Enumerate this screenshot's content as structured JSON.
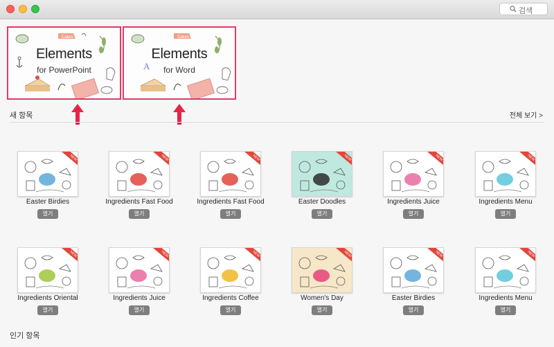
{
  "window": {
    "search_placeholder": "검색"
  },
  "banners": [
    {
      "title": "Elements",
      "subtitle": "for PowerPoint",
      "badge": "Cakes"
    },
    {
      "title": "Elements",
      "subtitle": "for Word",
      "badge": "Cakes"
    }
  ],
  "new_section": {
    "title": "새 항목",
    "see_all": "전체 보기 >"
  },
  "popular_section": {
    "title": "인기 항목"
  },
  "open_label": "열기",
  "ribbon_label": "NEW",
  "items": [
    {
      "name": "Easter Birdies",
      "bg": "#ffffff",
      "accent": "#5aa8d8"
    },
    {
      "name": "Ingredients Fast Food",
      "bg": "#ffffff",
      "accent": "#e2453b"
    },
    {
      "name": "Ingredients Fast Food",
      "bg": "#ffffff",
      "accent": "#e2453b"
    },
    {
      "name": "Easter Doodles",
      "bg": "#bfe8de",
      "accent": "#2c2c2c"
    },
    {
      "name": "Ingredients Juice",
      "bg": "#ffffff",
      "accent": "#e86aa0"
    },
    {
      "name": "Ingredients Menu",
      "bg": "#ffffff",
      "accent": "#5bc6d8"
    },
    {
      "name": "Ingredients Oriental",
      "bg": "#ffffff",
      "accent": "#9cc83a"
    },
    {
      "name": "Ingredients Juice",
      "bg": "#ffffff",
      "accent": "#e86aa0"
    },
    {
      "name": "Ingredients Coffee",
      "bg": "#ffffff",
      "accent": "#f0b626"
    },
    {
      "name": "Women's Day",
      "bg": "#f6e7c8",
      "accent": "#e8407a"
    },
    {
      "name": "Easter Birdies",
      "bg": "#ffffff",
      "accent": "#5aa8d8"
    },
    {
      "name": "Ingredients Menu",
      "bg": "#ffffff",
      "accent": "#5bc6d8"
    }
  ],
  "colors": {
    "highlight_border": "#e03868",
    "arrow": "#e8234a",
    "button": "#7e7e7e"
  }
}
